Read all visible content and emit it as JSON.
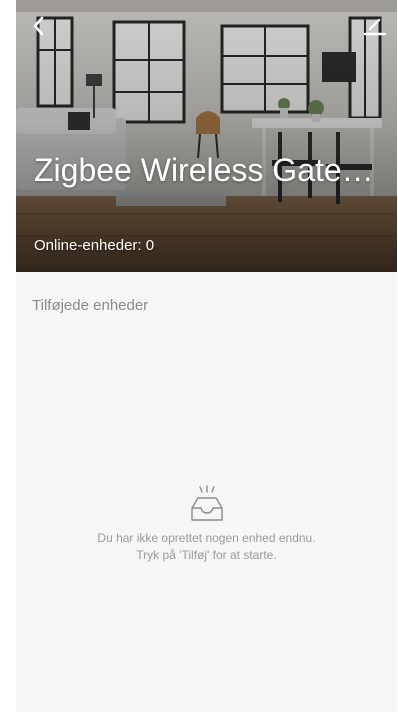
{
  "header": {
    "title": "Zigbee Wireless Gateway",
    "online_devices": "Online-enheder: 0"
  },
  "icons": {
    "back": "chevron-left-icon",
    "edit": "pencil-icon",
    "empty": "empty-inbox-icon"
  },
  "devices_section": {
    "title": "Tilføjede enheder"
  },
  "empty_state": {
    "line1": "Du har ikke oprettet nogen enhed endnu.",
    "line2": "Tryk på 'Tilføj' for at starte."
  },
  "colors": {
    "background": "#f6f6f6",
    "muted_text": "#8a8a8a"
  }
}
